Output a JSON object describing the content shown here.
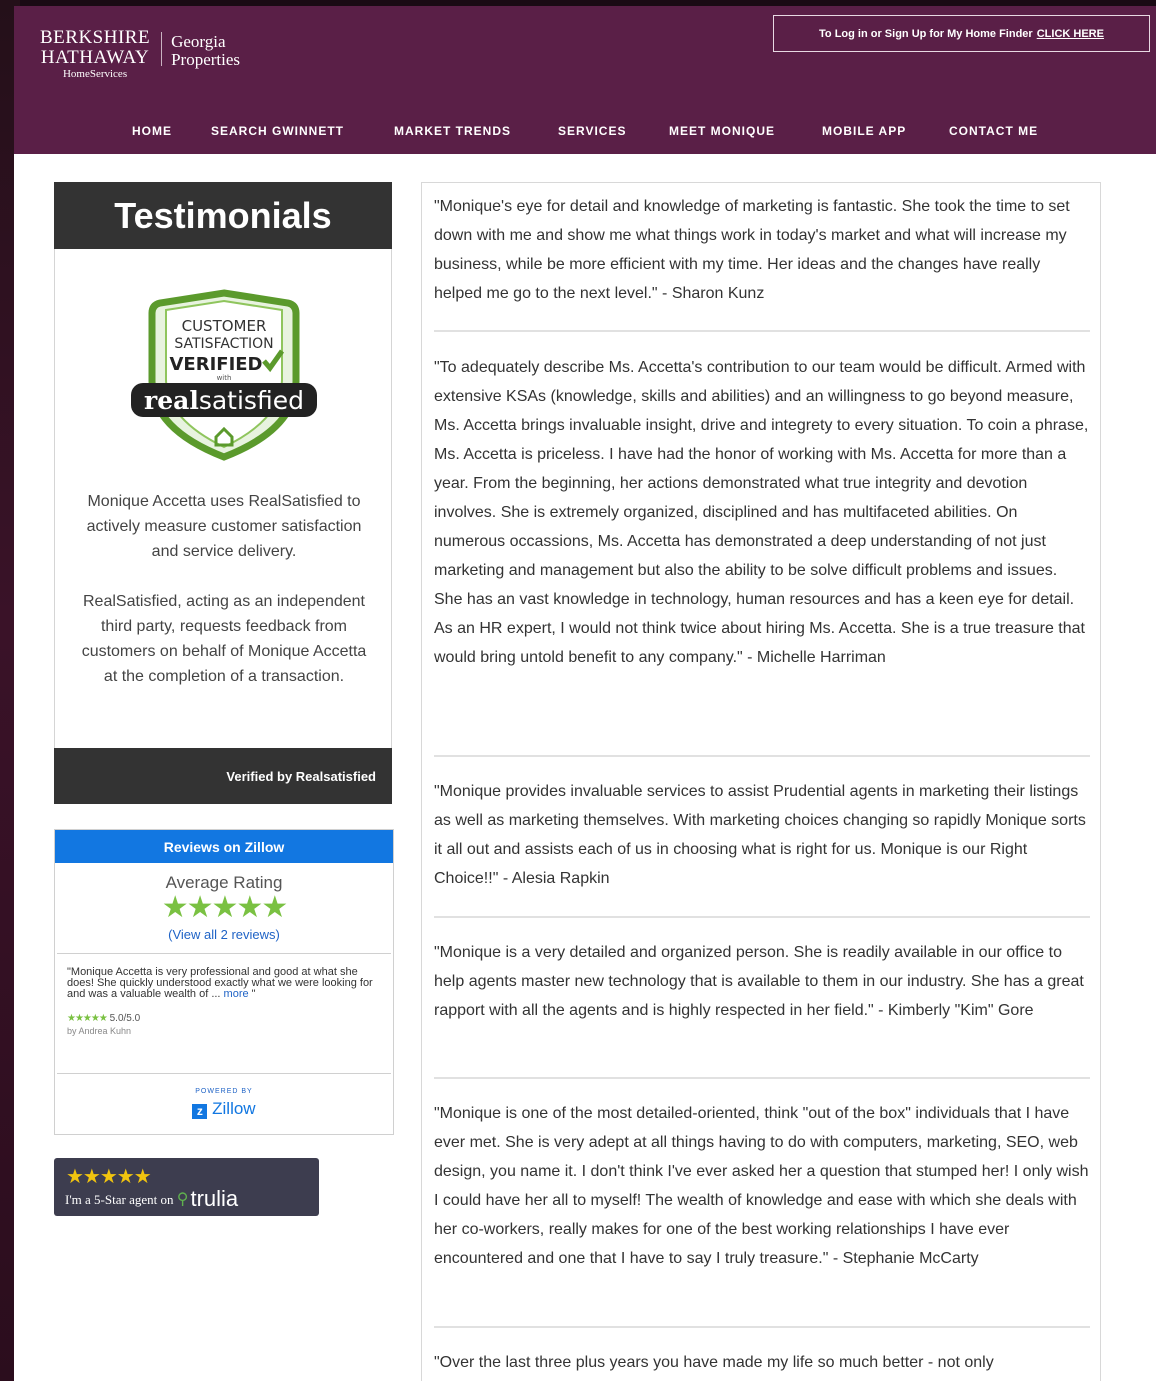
{
  "header": {
    "logo": {
      "line1": "BERKSHIRE",
      "line2": "HATHAWAY",
      "line3": "HomeServices",
      "sub1": "Georgia",
      "sub2": "Properties"
    },
    "login_text": "To Log in or Sign Up for My Home Finder",
    "login_link": "CLICK HERE",
    "nav": [
      "HOME",
      "SEARCH GWINNETT",
      "MARKET TRENDS",
      "SERVICES",
      "MEET MONIQUE",
      "MOBILE APP",
      "CONTACT ME"
    ]
  },
  "sidebar": {
    "testimonials_title": "Testimonials",
    "badge": {
      "line1": "CUSTOMER",
      "line2": "SATISFACTION",
      "line3": "VERIFIED",
      "line4": "with",
      "brand_bold": "real",
      "brand_light": "satisfied"
    },
    "para1": "Monique Accetta uses RealSatisfied to actively measure customer satisfaction and service delivery.",
    "para2": "RealSatisfied, acting as an independent third party, requests feedback from customers on behalf of Monique Accetta at the completion of a transaction.",
    "verified_by": "Verified by Realsatisfied",
    "zillow": {
      "header": "Reviews on Zillow",
      "average_label": "Average Rating",
      "stars": "★★★★★",
      "view_all": "(View all 2 reviews)",
      "quote": "\"Monique Accetta is very professional and good at what she does! She quickly understood exactly what we were looking for and was a valuable wealth of ...",
      "more": "more",
      "quote_end": "\"",
      "rating_stars": "★★★★★",
      "rating_value": "5.0/5.0",
      "by": "by Andrea Kuhn",
      "powered": "POWERED BY",
      "logo": "Zillow"
    },
    "trulia": {
      "stars": "★★★★★",
      "line": "I'm a 5-Star agent on",
      "brand": "trulia"
    }
  },
  "testimonials": [
    "\"Monique's eye for detail and knowledge of marketing is fantastic. She took the time to set down with me and show me what things work in today's market and what will increase my business, while be more efficient with my time. Her ideas and the changes have really helped me go to the next level.\" - Sharon Kunz",
    "\"To adequately describe Ms. Accetta's contribution to our team would be difficult. Armed with extensive KSAs (knowledge, skills and abilities) and an willingness to go beyond measure, Ms. Accetta brings invaluable insight, drive and integrety to every situation. To coin a phrase, Ms. Accetta is priceless. I have had the honor of working with Ms. Accetta for more than a year. From the beginning, her actions demonstrated what true integrity and devotion involves. She is extremely organized, disciplined and has multifaceted abilities. On numerous occassions, Ms. Accetta has demonstrated a deep understanding of not just marketing and management but also the ability to be solve difficult problems and issues. She has an vast knowledge in technology, human resources and has a keen eye for detail. As an HR expert, I would not think twice about hiring Ms. Accetta. She is a true treasure that would bring untold benefit to any company.\" - Michelle Harriman",
    "\"Monique provides invaluable services to assist Prudential agents in marketing their listings as well as marketing themselves. With marketing choices changing so rapidly Monique sorts it all out and assists each of us in choosing what is right for us. Monique is our Right Choice!!\" - Alesia Rapkin",
    "\"Monique is a very detailed and organized person. She is readily available in our office to help agents master new technology that is available to them in our industry. She has a great rapport with all the agents and is highly respected in her field.\" - Kimberly \"Kim\" Gore",
    "\"Monique is one of the most detailed-oriented, think \"out of the box\" individuals that I have ever met. She is very adept at all things having to do with computers, marketing, SEO, web design, you name it. I don't think I've ever asked her a question that stumped her! I only wish I could have her all to myself! The wealth of knowledge and ease with which she deals with her co-workers, really makes for one of the best working relationships I have ever encountered and one that I have to say I truly treasure.\" - Stephanie McCarty",
    "\"Over the last three plus years you have made my life so much better - not only"
  ]
}
